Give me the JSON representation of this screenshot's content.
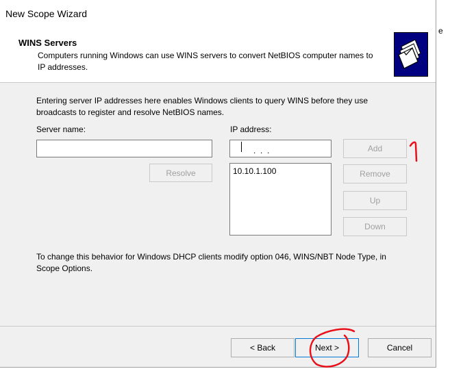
{
  "window": {
    "title": "New Scope Wizard"
  },
  "header": {
    "title": "WINS Servers",
    "subtitle": "Computers running Windows can use WINS servers to convert NetBIOS computer names to IP addresses.",
    "icon": "folders-icon"
  },
  "stray_text": "e",
  "intro_text": "Entering server IP addresses here enables Windows clients to query WINS before they use broadcasts to register and resolve NetBIOS names.",
  "server_name": {
    "label": "Server name:",
    "value": ""
  },
  "ip_address": {
    "label": "IP address:",
    "value": ".  .  ."
  },
  "buttons": {
    "resolve": "Resolve",
    "add": "Add",
    "remove": "Remove",
    "up": "Up",
    "down": "Down",
    "back": "< Back",
    "next": "Next >",
    "cancel": "Cancel"
  },
  "ip_list": [
    "10.10.1.100"
  ],
  "note_text": "To change this behavior for Windows DHCP clients modify option 046, WINS/NBT Node Type, in Scope Options.",
  "colors": {
    "annotation": "#e8111a",
    "header_icon_bg": "#000080",
    "focus_border": "#0078d7"
  }
}
